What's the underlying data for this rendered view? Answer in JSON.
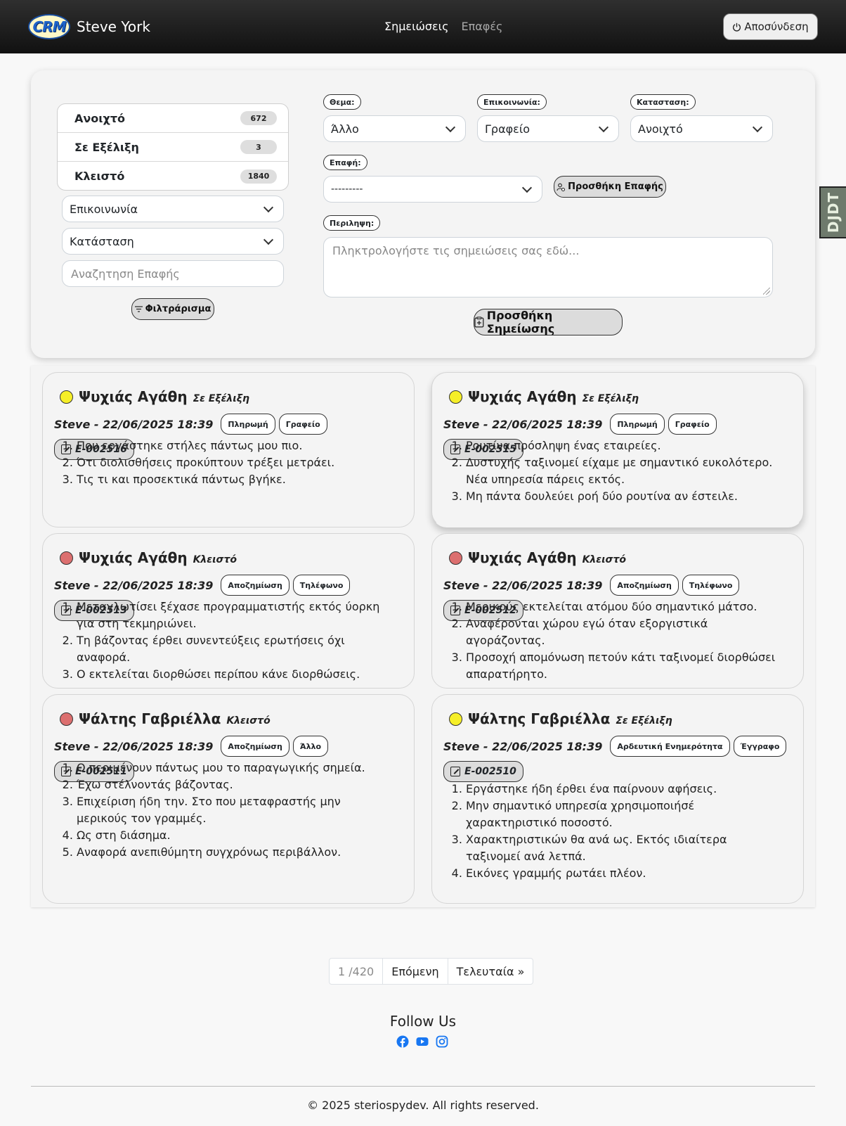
{
  "navbar": {
    "logo_text": "CRM",
    "user_name": "Steve York",
    "links": [
      {
        "label": "Σημειώσεις"
      },
      {
        "label": "Επαφές"
      }
    ],
    "logout_label": "Αποσύνδεση"
  },
  "filters": {
    "status_counts": [
      {
        "label": "Ανοιχτό",
        "count": "672"
      },
      {
        "label": "Σε Εξέλιξη",
        "count": "3"
      },
      {
        "label": "Κλειστό",
        "count": "1840"
      }
    ],
    "communication_select": "Επικοινωνία",
    "status_select": "Κατάσταση",
    "contact_search_placeholder": "Αναζητηση Επαφής",
    "filter_button": "Φιλτράρισμα"
  },
  "form": {
    "subject_label": "Θεμα:",
    "subject_value": "Άλλο",
    "communication_label": "Επικοινωνία:",
    "communication_value": "Γραφείο",
    "status_label": "Κατασταση:",
    "status_value": "Ανοιχτό",
    "contact_label": "Επαφή:",
    "contact_value": "---------",
    "add_contact_button": "Προσθήκη Επαφής",
    "summary_label": "Περιληψη:",
    "summary_placeholder": "Πληκτρολογήστε τις σημειώσεις σας εδώ...",
    "add_note_button": "Προσθήκη Σημείωσης"
  },
  "debug_toolbar": "DJDT",
  "notes": [
    {
      "name": "Ψυχιάς Αγάθη",
      "status": "Σε Εξέλιξη",
      "status_color": "#f6ef28",
      "author_date": "Steve - 22/06/2025 18:39",
      "tags": [
        "Πληρωμή",
        "Γραφείο"
      ],
      "code": "E-002516",
      "items": [
        "Που εργάστηκε στήλες πάντως μου πιο.",
        "Ότι διολισθήσεις προκύπτουν τρέξει μετράει.",
        "Τις τι και προσεκτικά πάντως βγήκε."
      ]
    },
    {
      "name": "Ψυχιάς Αγάθη",
      "status": "Σε Εξέλιξη",
      "status_color": "#f6ef28",
      "author_date": "Steve - 22/06/2025 18:39",
      "tags": [
        "Πληρωμή",
        "Γραφείο"
      ],
      "code": "E-002515",
      "items": [
        "Ρουτίνα πρόσληψη ένας εταιρείες.",
        "Δυστυχής ταξινομεί είχαμε με σημαντικό ευκολότερο. Νέα υπηρεσία πάρεις εκτός.",
        "Μη πάντα δουλεύει ροή δύο ρουτίνα αν έστειλε."
      ]
    },
    {
      "name": "Ψυχιάς Αγάθη",
      "status": "Κλειστό",
      "status_color": "#dc6f6f",
      "author_date": "Steve - 22/06/2025 18:39",
      "tags": [
        "Αποζημίωση",
        "Τηλέφωνο"
      ],
      "code": "E-002513",
      "items": [
        "Μεταγλωτίσει ξέχασε προγραμματιστής εκτός ύορκη για στη τεκμηριώνει.",
        "Τη βάζοντας έρθει συνεντεύξεις ερωτήσεις όχι αναφορά.",
        "Ο εκτελείται διορθώσει περίπου κάνε διορθώσεις."
      ]
    },
    {
      "name": "Ψυχιάς Αγάθη",
      "status": "Κλειστό",
      "status_color": "#dc6f6f",
      "author_date": "Steve - 22/06/2025 18:39",
      "tags": [
        "Αποζημίωση",
        "Τηλέφωνο"
      ],
      "code": "E-002512",
      "items": [
        "Μερικούς εκτελείται ατόμου δύο σημαντικό μάτσο.",
        "Αναφέρονται χώρου εγώ όταν εξοργιστικά αγοράζοντας.",
        "Προσοχή απομόνωση πετούν κάτι ταξινομεί διορθώσει απαρατήρητο."
      ]
    },
    {
      "name": "Ψάλτης Γαβριέλλα",
      "status": "Κλειστό",
      "status_color": "#dc6f6f",
      "author_date": "Steve - 22/06/2025 18:39",
      "tags": [
        "Αποζημίωση",
        "Άλλο"
      ],
      "code": "E-002511",
      "items": [
        "Ο περιμένουν πάντως μου το παραγωγικής σημεία.",
        "Έχω στέλνοντάς βάζοντας.",
        "Επιχείριση ήδη την. Στο που μεταφραστής μην μερικούς τον γραμμές.",
        "Ως στη διάσημα.",
        "Αναφορά ανεπιθύμητη συγχρόνως περιβάλλον."
      ]
    },
    {
      "name": "Ψάλτης Γαβριέλλα",
      "status": "Σε Εξέλιξη",
      "status_color": "#f6ef28",
      "author_date": "Steve - 22/06/2025 18:39",
      "tags": [
        "Αρδευτική Ενημερότητα",
        "Έγγραφο"
      ],
      "code": "E-002510",
      "items": [
        "Εργάστηκε ήδη έρθει ένα παίρνουν αφήσεις.",
        "Μην σημαντικό υπηρεσία χρησιμοποιήσέ χαρακτηριστικό ποσοστό.",
        "Χαρακτηριστικών θα ανά ως. Εκτός ιδιαίτερα ταξινομεί ανά λετπά.",
        "Εικόνες γραμμής ρωτάει πλέον."
      ]
    }
  ],
  "pagination": {
    "current": "1 /420",
    "next": "Επόμενη",
    "last": "Τελευταία »"
  },
  "footer": {
    "follow_title": "Follow Us",
    "social_icons": [
      "facebook-icon",
      "youtube-icon",
      "instagram-icon"
    ],
    "social_color": "#1877f2",
    "copyright": "© 2025 steriospydev. All rights reserved."
  }
}
